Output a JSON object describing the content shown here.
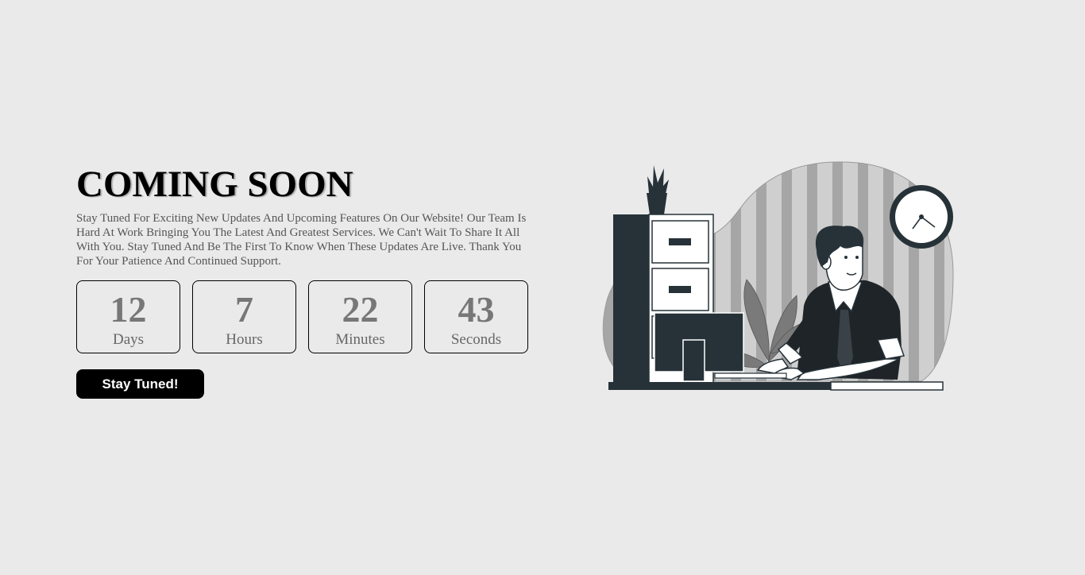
{
  "hero": {
    "title": "COMING SOON",
    "description": "Stay Tuned For Exciting New Updates And Upcoming Features On Our Website! Our Team Is Hard At Work Bringing You The Latest And Greatest Services. We Can't Wait To Share It All With You. Stay Tuned And Be The First To Know When These Updates Are Live. Thank You For Your Patience And Continued Support."
  },
  "countdown": [
    {
      "value": "12",
      "label": "Days"
    },
    {
      "value": "7",
      "label": "Hours"
    },
    {
      "value": "22",
      "label": "Minutes"
    },
    {
      "value": "43",
      "label": "Seconds"
    }
  ],
  "cta": {
    "label": "Stay Tuned!"
  },
  "illustration": {
    "subject": "person-working-at-computer",
    "icons": [
      "wall-clock-icon",
      "potted-plant-icon",
      "filing-cabinet-icon",
      "computer-monitor-icon"
    ]
  },
  "colors": {
    "background": "#eaeaea",
    "primary": "#000000",
    "number_text": "#777777",
    "illustration_dark": "#263238"
  }
}
